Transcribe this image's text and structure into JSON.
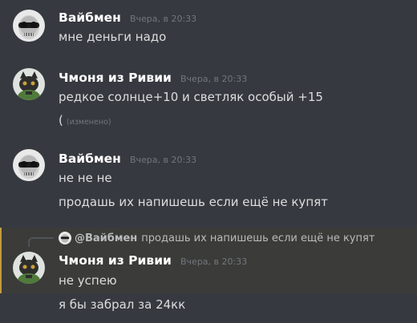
{
  "messages": [
    {
      "author": "Вайбмен",
      "timestamp": "Вчера, в 20:33",
      "avatar": "skull-sunglasses-avatar",
      "lines": [
        "мне деньги надо"
      ]
    },
    {
      "author": "Чмоня из Ривии",
      "timestamp": "Вчера, в 20:33",
      "avatar": "dark-cat-avatar",
      "lines": [
        "редкое солнце+10 и светляк особый +15",
        "("
      ],
      "edited_label": "(изменено)"
    },
    {
      "author": "Вайбмен",
      "timestamp": "Вчера, в 20:33",
      "avatar": "skull-sunglasses-avatar",
      "lines": [
        "не не не",
        "продашь их напишешь если ещё не купят"
      ]
    },
    {
      "author": "Чмоня из Ривии",
      "timestamp": "Вчера, в 20:33",
      "avatar": "dark-cat-avatar",
      "reply_to": {
        "author": "@Вайбмен",
        "text": "продашь их напишешь если ещё не купят"
      },
      "lines": [
        "не успею",
        "я бы забрал за 24кк"
      ]
    }
  ],
  "colors": {
    "background": "#36393f",
    "author": "#ffffff",
    "timestamp": "#72767d",
    "message_text": "#dcddde",
    "mention_highlight_bar": "#c39b3f",
    "mention_highlight_bg": "#3b3b39"
  }
}
